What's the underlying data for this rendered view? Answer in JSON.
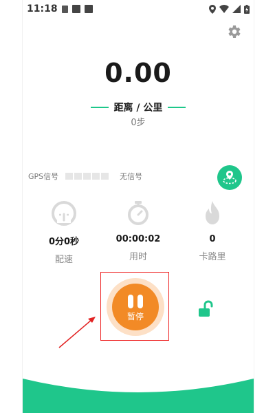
{
  "status_bar": {
    "time": "11:18",
    "icons_left": [
      "notification-a-icon",
      "app-icon",
      "app-icon"
    ],
    "icons_right": [
      "location-icon",
      "wifi-icon",
      "signal-icon",
      "battery-icon"
    ]
  },
  "header": {
    "settings_icon": "gear-icon"
  },
  "distance": {
    "value": "0.00",
    "label": "距离 / 公里",
    "steps": "0步"
  },
  "gps": {
    "label": "GPS信号",
    "signal_level": 0,
    "status": "无信号"
  },
  "stats": [
    {
      "icon": "speedometer-icon",
      "value": "0分0秒",
      "label": "配速"
    },
    {
      "icon": "stopwatch-icon",
      "value": "00:00:02",
      "label": "用时"
    },
    {
      "icon": "flame-icon",
      "value": "0",
      "label": "卡路里"
    }
  ],
  "controls": {
    "pause_label": "暂停",
    "lock_icon": "unlock-icon"
  },
  "colors": {
    "accent": "#1fc68b",
    "pause": "#f28a26",
    "pause_ring": "#fde0c6",
    "annotation": "#e22222"
  }
}
